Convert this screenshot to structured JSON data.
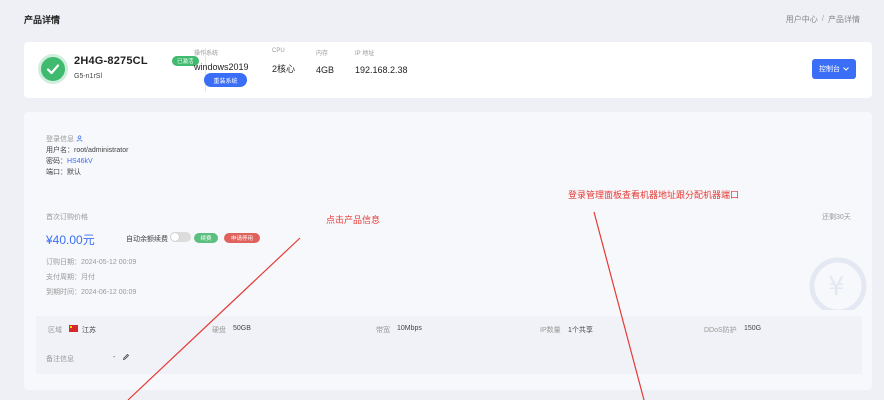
{
  "header": {
    "title": "产品详情",
    "breadcrumb": [
      "用户中心",
      "/",
      "产品详情"
    ]
  },
  "product": {
    "name": "2H4G-8275CL",
    "status_badge": "已激活",
    "model": "G5-n1rSl",
    "os_label": "操作系统",
    "os_value": "windows2019",
    "reinstall_button": "重装系统",
    "cpu_label": "CPU",
    "cpu_value": "2核心",
    "ram_label": "内存",
    "ram_value": "4GB",
    "ip_label": "IP 地址",
    "ip_value": "192.168.2.38",
    "console_button": "控制台"
  },
  "login": {
    "title": "登录信息",
    "username_label": "用户名：",
    "username_value": "root/administrator",
    "password_label": "密码：",
    "password_value": "HS46kV",
    "port_label": "端口：",
    "port_value": "默认"
  },
  "billing": {
    "first_price_label": "首次订购价格",
    "price": "¥40.00元",
    "auto_renew_label": "自动余额续费",
    "renew_button": "续费",
    "stop_button": "申请停用",
    "expire_note": "还剩30天",
    "order_date_label": "订购日期：",
    "order_date_value": "2024-05-12 00:09",
    "pay_cycle_label": "支付周期：",
    "pay_cycle_value": "月付",
    "due_date_label": "到期时间：",
    "due_date_value": "2024-06-12 00:09"
  },
  "specs": {
    "region_label": "区域",
    "region_value": "江苏",
    "disk_label": "硬盘",
    "disk_value": "50GB",
    "bandwidth_label": "带宽",
    "bandwidth_value": "10Mbps",
    "ipcount_label": "IP数量",
    "ipcount_value": "1个共享",
    "ddos_label": "DDoS防护",
    "ddos_value": "150G",
    "note_label": "备注信息",
    "note_value": "-"
  },
  "annotations": {
    "click_product": "点击产品信息",
    "login_panel": "登录管理面板查看机器地址跟分配机器端口"
  },
  "colors": {
    "accent": "#3a6ef6",
    "success": "#3fba6e",
    "danger": "#e0625c",
    "annotation": "#e53935"
  }
}
